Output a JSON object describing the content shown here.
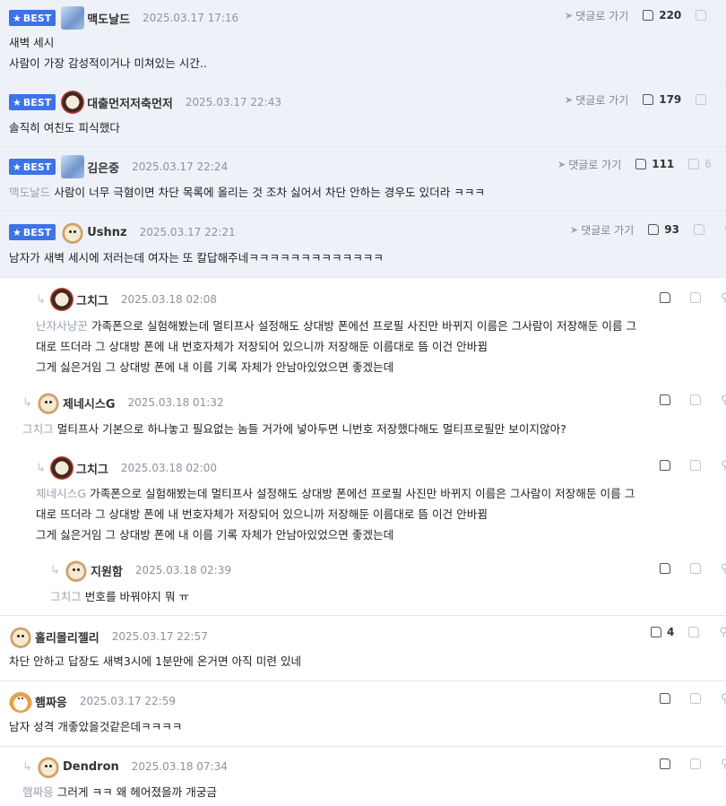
{
  "ui": {
    "best_label": "BEST",
    "goto_label": "댓글로 가기",
    "reply_arrow": "↳"
  },
  "comments": [
    {
      "nick": "맥도날드",
      "date": "2025.03.17 17:16",
      "mention": "",
      "lines": [
        "새벽 세시",
        "사람이 가장 감성적이거나 미쳐있는 시간.."
      ],
      "likes": "220",
      "dislikes": ""
    },
    {
      "nick": "대출먼저저축먼저",
      "date": "2025.03.17 22:43",
      "mention": "",
      "lines": [
        "솔직히 여친도 피식했다"
      ],
      "likes": "179",
      "dislikes": ""
    },
    {
      "nick": "김은중",
      "date": "2025.03.17 22:24",
      "mention": "맥도날드",
      "lines": [
        "사람이 너무 극혐이면 차단 목록에 올리는 것 조차 싫어서 차단 안하는 경우도 있더라 ㅋㅋㅋ"
      ],
      "likes": "111",
      "dislikes": "6"
    },
    {
      "nick": "Ushnz",
      "date": "2025.03.17 22:21",
      "mention": "",
      "lines": [
        "남자가 새벽 세시에 저러는데 여자는 또 칼답해주네ㅋㅋㅋㅋㅋㅋㅋㅋㅋㅋㅋㅋㅋ"
      ],
      "likes": "93",
      "dislikes": ""
    },
    {
      "nick": "그치그",
      "date": "2025.03.18 02:08",
      "mention": "난자사냥꾼",
      "lines": [
        "가족폰으로 실험해봤는데 멀티프사 설정해도 상대방 폰에선 프로필 사진만 바뀌지 이름은 그사람이 저장해둔 이름 그",
        "대로 뜨더라 그 상대방 폰에 내 번호자체가 저장되어 있으니까 저장해둔 이름대로 뜸 이건 안바뀜",
        "그게 싫은거임 그 상대방 폰에 내 이름 기록 자체가 안남아있었으면 좋겠는데"
      ],
      "likes": "",
      "dislikes": ""
    },
    {
      "nick": "제네시스G",
      "date": "2025.03.18 01:32",
      "mention": "그치그",
      "lines": [
        "멀티프사 기본으로 하나놓고 필요없는 놈들 거가에 넣아두면 니번호 저장했다해도 멀티프로필만 보이지않아?"
      ],
      "likes": "",
      "dislikes": ""
    },
    {
      "nick": "그치그",
      "date": "2025.03.18 02:00",
      "mention": "제네시스G",
      "lines": [
        "가족폰으로 실험해봤는데 멀티프사 설정해도 상대방 폰에선 프로필 사진만 바뀌지 이름은 그사람이 저장해둔 이름 그",
        "대로 뜨더라 그 상대방 폰에 내 번호자체가 저장되어 있으니까 저장해둔 이름대로 뜸 이건 안바뀜",
        "그게 싫은거임 그 상대방 폰에 내 이름 기록 자체가 안남아있었으면 좋겠는데"
      ],
      "likes": "",
      "dislikes": ""
    },
    {
      "nick": "지원함",
      "date": "2025.03.18 02:39",
      "mention": "그치그",
      "lines": [
        "번호를 바꿔야지 뭐 ㅠ"
      ],
      "likes": "",
      "dislikes": ""
    },
    {
      "nick": "홀리몰리젤리",
      "date": "2025.03.17 22:57",
      "mention": "",
      "lines": [
        "차단 안하고 답장도 새벽3시에 1분만에 온거면 아직 미련 있네"
      ],
      "likes": "4",
      "dislikes": ""
    },
    {
      "nick": "햄짜응",
      "date": "2025.03.17 22:59",
      "mention": "",
      "lines": [
        "남자 성격 개좋았을것같은데ㅋㅋㅋㅋ"
      ],
      "likes": "",
      "dislikes": ""
    },
    {
      "nick": "Dendron",
      "date": "2025.03.18 07:34",
      "mention": "햄짜응",
      "lines": [
        "그러게 ㅋㅋ 왜 헤어졌을까 개궁금"
      ],
      "likes": "",
      "dislikes": ""
    }
  ]
}
